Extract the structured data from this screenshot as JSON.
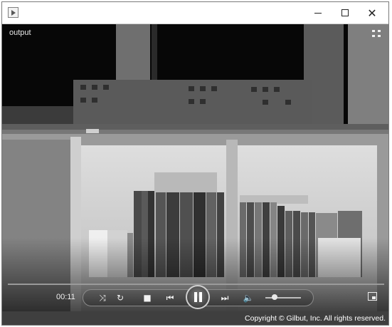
{
  "window": {
    "title": "",
    "buttons": {
      "minimize": "minimize",
      "maximize": "maximize",
      "close": "close"
    }
  },
  "video": {
    "overlay_label": "output",
    "fullscreen_icon": "fullscreen-toggle-icon"
  },
  "player": {
    "time": "00:11",
    "controls": [
      "shuffle-icon",
      "repeat-icon",
      "stop-icon",
      "previous-icon",
      "pause-icon",
      "next-icon",
      "volume-icon",
      "switch-to-now-playing-icon"
    ]
  },
  "footer": {
    "copyright": "Copyright © Gilbut, Inc. All rights reserved."
  },
  "colors": {
    "title_bar": "#ffffff",
    "video_background": "#111111",
    "controls_text": "#f0f0f0",
    "footer_background": "#3f3f3f"
  }
}
